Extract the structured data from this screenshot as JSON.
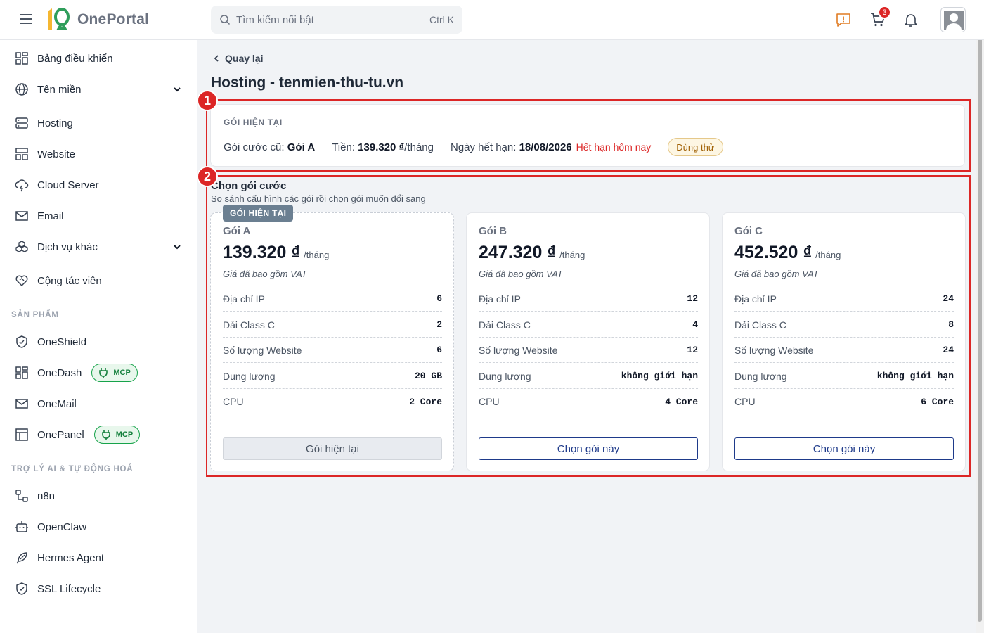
{
  "app": {
    "name": "OnePortal"
  },
  "search": {
    "placeholder": "Tìm kiếm nổi bật",
    "shortcut": "Ctrl K"
  },
  "header": {
    "cart_count": "3"
  },
  "sidebar": {
    "items": [
      {
        "label": "Bảng điều khiển",
        "icon": "dashboard-icon"
      },
      {
        "label": "Tên miền",
        "icon": "globe-icon",
        "expandable": true
      },
      {
        "label": "Hosting",
        "icon": "server-icon"
      },
      {
        "label": "Website",
        "icon": "website-icon"
      },
      {
        "label": "Cloud Server",
        "icon": "cloud-icon"
      },
      {
        "label": "Email",
        "icon": "mail-icon"
      },
      {
        "label": "Dịch vụ khác",
        "icon": "boxes-icon",
        "expandable": true
      },
      {
        "label": "Cộng tác viên",
        "icon": "handshake-icon"
      }
    ],
    "products_title": "SẢN PHẨM",
    "products": [
      {
        "label": "OneShield",
        "icon": "shield-icon"
      },
      {
        "label": "OneDash",
        "icon": "dashboard-icon",
        "badge": "MCP"
      },
      {
        "label": "OneMail",
        "icon": "mail-icon"
      },
      {
        "label": "OnePanel",
        "icon": "panel-icon",
        "badge": "MCP"
      }
    ],
    "ai_title": "TRỢ LÝ AI & TỰ ĐỘNG HOÁ",
    "ai": [
      {
        "label": "n8n",
        "icon": "workflow-icon"
      },
      {
        "label": "OpenClaw",
        "icon": "robot-icon"
      },
      {
        "label": "Hermes Agent",
        "icon": "feather-icon"
      },
      {
        "label": "SSL Lifecycle",
        "icon": "shield-check-icon"
      }
    ]
  },
  "main": {
    "back_label": "Quay lại",
    "title": "Hosting - tenmien-thu-tu.vn",
    "current": {
      "heading": "GÓI HIỆN TẠI",
      "old_plan_label": "Gói cước cũ:",
      "old_plan_value": "Gói A",
      "price_label": "Tiền:",
      "price_value": "139.320 ₫",
      "price_unit": "/tháng",
      "expiry_label": "Ngày hết hạn:",
      "expiry_value": "18/08/2026",
      "expiry_status": "Hết hạn hôm nay",
      "trial_badge": "Dùng thử"
    },
    "select": {
      "title": "Chọn gói cước",
      "subtitle": "So sánh cấu hình các gói rồi chọn gói muốn đổi sang"
    },
    "plans": [
      {
        "name": "Gói A",
        "price": "139.320 ₫",
        "unit": "/tháng",
        "vat": "Giá đã bao gồm VAT",
        "current_tag": "GÓI HIỆN TẠI",
        "specs": [
          {
            "key": "Địa chỉ IP",
            "value": "6"
          },
          {
            "key": "Dải Class C",
            "value": "2"
          },
          {
            "key": "Số lượng Website",
            "value": "6"
          },
          {
            "key": "Dung lượng",
            "value": "20 GB"
          },
          {
            "key": "CPU",
            "value": "2 Core"
          }
        ],
        "button": "Gói hiện tại"
      },
      {
        "name": "Gói B",
        "price": "247.320 ₫",
        "unit": "/tháng",
        "vat": "Giá đã bao gồm VAT",
        "specs": [
          {
            "key": "Địa chỉ IP",
            "value": "12"
          },
          {
            "key": "Dải Class C",
            "value": "4"
          },
          {
            "key": "Số lượng Website",
            "value": "12"
          },
          {
            "key": "Dung lượng",
            "value": "không giới hạn"
          },
          {
            "key": "CPU",
            "value": "4 Core"
          }
        ],
        "button": "Chọn gói này"
      },
      {
        "name": "Gói C",
        "price": "452.520 ₫",
        "unit": "/tháng",
        "vat": "Giá đã bao gồm VAT",
        "specs": [
          {
            "key": "Địa chỉ IP",
            "value": "24"
          },
          {
            "key": "Dải Class C",
            "value": "8"
          },
          {
            "key": "Số lượng Website",
            "value": "24"
          },
          {
            "key": "Dung lượng",
            "value": "không giới hạn"
          },
          {
            "key": "CPU",
            "value": "6 Core"
          }
        ],
        "button": "Chọn gói này"
      }
    ]
  },
  "annotations": [
    "1",
    "2"
  ],
  "colors": {
    "accent": "#1e3a8a",
    "annotation": "#dc2626",
    "logo_orange": "#f59e0b",
    "logo_green": "#16a34a",
    "danger": "#dc2626"
  }
}
